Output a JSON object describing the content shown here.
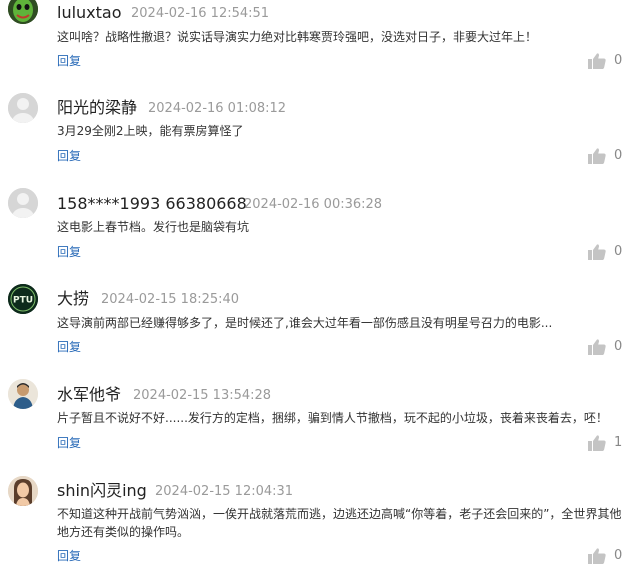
{
  "ui": {
    "reply_label": "回复"
  },
  "comments": [
    {
      "username": "luluxtao",
      "timestamp": "2024-02-16 12:54:51",
      "text": "这叫啥？战略性撤退？说实话导演实力绝对比韩寒贾玲强吧，没选对日子，非要大过年上！",
      "likes": "0",
      "avatar_icon": "green-mask-avatar-icon"
    },
    {
      "username": "阳光的梁静",
      "timestamp": "2024-02-16 01:08:12",
      "text": "3月29全刚2上映，能有票房算怪了",
      "likes": "0",
      "avatar_icon": "default-avatar-icon"
    },
    {
      "username": "158****1993 66380668",
      "timestamp": "2024-02-16 00:36:28",
      "text": "这电影上春节档。发行也是脑袋有坑",
      "likes": "0",
      "avatar_icon": "default-avatar-icon"
    },
    {
      "username": "大捞",
      "timestamp": "2024-02-15 18:25:40",
      "text": "这导演前两部已经赚得够多了，是时候还了,谁会大过年看一部伤感且没有明星号召力的电影...",
      "likes": "0",
      "avatar_icon": "ptu-logo-avatar-icon",
      "avatar_logo_text": "PTU"
    },
    {
      "username": "水军他爷",
      "timestamp": "2024-02-15 13:54:28",
      "text": "片子暂且不说好不好......发行方的定档，捆绑，骗到情人节撤档，玩不起的小垃圾，丧着来丧着去，呸！",
      "likes": "1",
      "avatar_icon": "person-avatar-icon"
    },
    {
      "username": "shin闪灵ing",
      "timestamp": "2024-02-15 12:04:31",
      "text": "不知道这种开战前气势汹汹，一俟开战就落荒而逃，边逃还边高喊“你等着，老子还会回来的”，全世界其他地方还有类似的操作吗。",
      "likes": "0",
      "avatar_icon": "woman-avatar-icon"
    }
  ]
}
